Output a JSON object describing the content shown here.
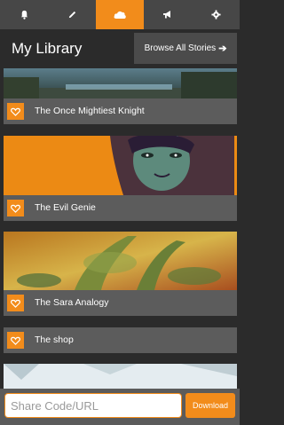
{
  "tabs": [
    {
      "icon": "bell-icon"
    },
    {
      "icon": "pencil-icon"
    },
    {
      "icon": "cloud-icon",
      "active": true
    },
    {
      "icon": "megaphone-icon"
    },
    {
      "icon": "gear-icon"
    }
  ],
  "header": {
    "title": "My Library",
    "browse_label": "Browse All Stories",
    "browse_arrow": "➔"
  },
  "stories": [
    {
      "title": "The Once Mightiest Knight"
    },
    {
      "title": "The Evil Genie"
    },
    {
      "title": "The Sara Analogy"
    },
    {
      "title": "The shop"
    }
  ],
  "share": {
    "placeholder": "Share Code/URL",
    "download_label": "Download"
  },
  "colors": {
    "accent": "#f28c1b",
    "bar": "#474747",
    "card": "#5c5c5c"
  }
}
